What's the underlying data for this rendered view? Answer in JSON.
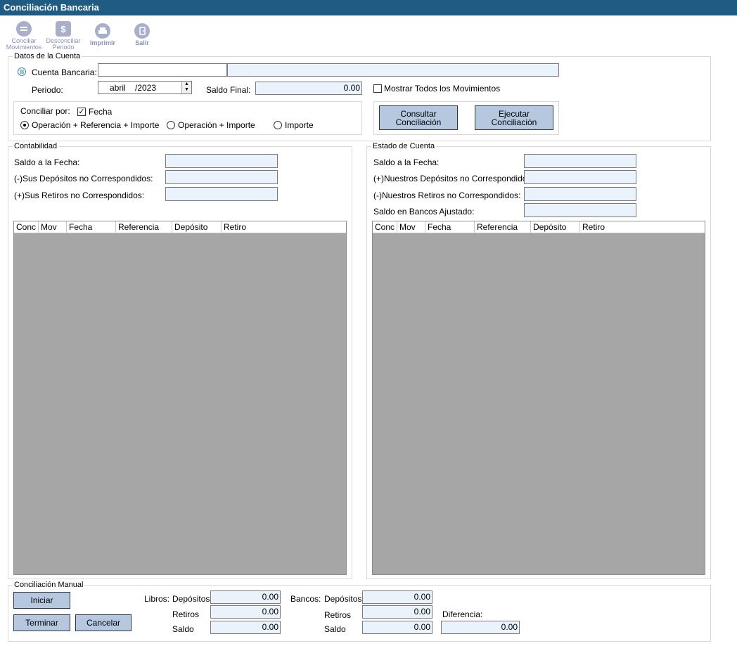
{
  "window": {
    "title": "Conciliación Bancaria"
  },
  "toolbar": {
    "conciliar": "Conciliar Movimientos",
    "desconciliar": "Desconciliar Periodo",
    "imprimir": "Imprimir",
    "salir": "Salir"
  },
  "cuenta": {
    "legend": "Datos de la Cuenta",
    "cuenta_label": "Cuenta Bancaria:",
    "cuenta_value": "",
    "cuenta_desc": "",
    "periodo_label": "Periodo:",
    "periodo_month": "abril",
    "periodo_year": "/2023",
    "saldo_final_label": "Saldo Final:",
    "saldo_final_value": "0.00",
    "mostrar_label": "Mostrar Todos los Movimientos",
    "conciliar_por_label": "Conciliar por:",
    "fecha_label": "Fecha",
    "opt1": "Operación + Referencia + Importe",
    "opt2": "Operación + Importe",
    "opt3": "Importe",
    "consultar_btn": "Consultar\nConciliación",
    "ejecutar_btn": "Ejecutar\nConciliación"
  },
  "contabilidad": {
    "legend": "Contabilidad",
    "saldo_fecha": "Saldo a la Fecha:",
    "depositos_nc": "(-)Sus Depósitos no Correspondidos:",
    "retiros_nc": "(+)Sus Retiros no Correspondidos:",
    "columns": [
      "Conc",
      "Mov",
      "Fecha",
      "Referencia",
      "Depósito",
      "Retiro"
    ]
  },
  "estado": {
    "legend": "Estado de Cuenta",
    "saldo_fecha": "Saldo a la Fecha:",
    "depositos_nc": "(+)Nuestros Depósitos no Correspondidos:",
    "retiros_nc": "(-)Nuestros Retiros no Correspondidos:",
    "saldo_ajustado": "Saldo en Bancos Ajustado:",
    "columns": [
      "Conc",
      "Mov",
      "Fecha",
      "Referencia",
      "Depósito",
      "Retiro"
    ]
  },
  "manual": {
    "legend": "Conciliación Manual",
    "iniciar": "Iniciar",
    "terminar": "Terminar",
    "cancelar": "Cancelar",
    "libros_label": "Libros:",
    "bancos_label": "Bancos:",
    "depositos": "Depósitos",
    "retiros": "Retiros",
    "saldo": "Saldo",
    "diferencia": "Diferencia:",
    "libros_dep": "0.00",
    "libros_ret": "0.00",
    "libros_saldo": "0.00",
    "bancos_dep": "0.00",
    "bancos_ret": "0.00",
    "bancos_saldo": "0.00",
    "diferencia_value": "0.00"
  }
}
